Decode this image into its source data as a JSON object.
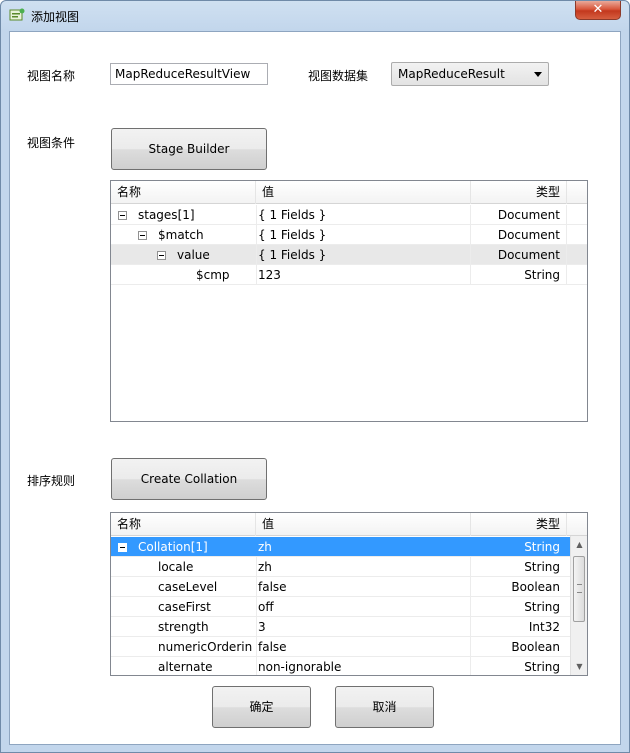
{
  "window": {
    "title": "添加视图",
    "close_label": "✕"
  },
  "form": {
    "view_name_label": "视图名称",
    "view_name_value": "MapReduceResultView",
    "dataset_label": "视图数据集",
    "dataset_value": "MapReduceResult",
    "condition_label": "视图条件",
    "stage_builder_label": "Stage Builder",
    "sort_label": "排序规则",
    "create_collation_label": "Create Collation",
    "ok_label": "确定",
    "cancel_label": "取消"
  },
  "stage_grid": {
    "columns": {
      "name": "名称",
      "value": "值",
      "type": "类型"
    },
    "rows": [
      {
        "name": "stages[1]",
        "value": "{ 1 Fields }",
        "type": "Document",
        "expander": true
      },
      {
        "name": "$match",
        "value": "{ 1 Fields }",
        "type": "Document",
        "expander": true
      },
      {
        "name": "value",
        "value": "{ 1 Fields }",
        "type": "Document",
        "expander": true
      },
      {
        "name": "$cmp",
        "value": "123",
        "type": "String",
        "expander": false
      }
    ]
  },
  "collation_grid": {
    "columns": {
      "name": "名称",
      "value": "值",
      "type": "类型"
    },
    "rows": [
      {
        "name": "Collation[1]",
        "value": "zh",
        "type": "String"
      },
      {
        "name": "locale",
        "value": "zh",
        "type": "String"
      },
      {
        "name": "caseLevel",
        "value": "false",
        "type": "Boolean"
      },
      {
        "name": "caseFirst",
        "value": "off",
        "type": "String"
      },
      {
        "name": "strength",
        "value": "3",
        "type": "Int32"
      },
      {
        "name": "numericOrderin",
        "value": "false",
        "type": "Boolean"
      },
      {
        "name": "alternate",
        "value": "non-ignorable",
        "type": "String"
      }
    ]
  },
  "icons": {
    "app": "view-add-icon",
    "dropdown": "chevron-down-icon",
    "collapse": "minus-box-icon"
  },
  "colors": {
    "selection": "#3399ff",
    "close": "#c3381e"
  }
}
